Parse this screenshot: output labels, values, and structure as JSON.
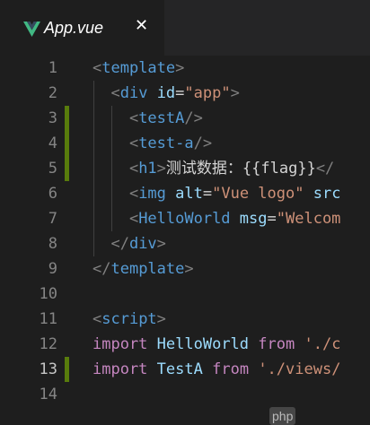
{
  "tab": {
    "title": "App.vue",
    "icon": "vue-logo-icon",
    "close": "✕"
  },
  "editor": {
    "lines": [
      {
        "n": "1",
        "segs": [
          [
            "p",
            "<"
          ],
          [
            "tg",
            "template"
          ],
          [
            "p",
            ">"
          ]
        ]
      },
      {
        "n": "2",
        "segs": [
          [
            "p",
            "  <"
          ],
          [
            "tg",
            "div"
          ],
          [
            "tx",
            " "
          ],
          [
            "at",
            "id"
          ],
          [
            "tx",
            "="
          ],
          [
            "st",
            "\"app\""
          ],
          [
            "p",
            ">"
          ]
        ]
      },
      {
        "n": "3",
        "mark": true,
        "segs": [
          [
            "p",
            "    <"
          ],
          [
            "tg",
            "testA"
          ],
          [
            "p",
            "/>"
          ]
        ]
      },
      {
        "n": "4",
        "mark": true,
        "segs": [
          [
            "p",
            "    <"
          ],
          [
            "tg",
            "test-a"
          ],
          [
            "p",
            "/>"
          ]
        ]
      },
      {
        "n": "5",
        "mark": true,
        "segs": [
          [
            "p",
            "    <"
          ],
          [
            "tg",
            "h1"
          ],
          [
            "p",
            ">"
          ],
          [
            "tx",
            "测试数据：{{flag}}"
          ],
          [
            "p",
            "</"
          ]
        ]
      },
      {
        "n": "6",
        "segs": [
          [
            "p",
            "    <"
          ],
          [
            "tg",
            "img"
          ],
          [
            "tx",
            " "
          ],
          [
            "at",
            "alt"
          ],
          [
            "tx",
            "="
          ],
          [
            "st",
            "\"Vue logo\""
          ],
          [
            "tx",
            " "
          ],
          [
            "at",
            "src"
          ]
        ]
      },
      {
        "n": "7",
        "segs": [
          [
            "p",
            "    <"
          ],
          [
            "tg",
            "HelloWorld"
          ],
          [
            "tx",
            " "
          ],
          [
            "at",
            "msg"
          ],
          [
            "tx",
            "="
          ],
          [
            "st",
            "\"Welcom"
          ]
        ]
      },
      {
        "n": "8",
        "segs": [
          [
            "p",
            "  </"
          ],
          [
            "tg",
            "div"
          ],
          [
            "p",
            ">"
          ]
        ]
      },
      {
        "n": "9",
        "segs": [
          [
            "p",
            "</"
          ],
          [
            "tg",
            "template"
          ],
          [
            "p",
            ">"
          ]
        ]
      },
      {
        "n": "10",
        "segs": []
      },
      {
        "n": "11",
        "segs": [
          [
            "p",
            "<"
          ],
          [
            "tg",
            "script"
          ],
          [
            "p",
            ">"
          ]
        ]
      },
      {
        "n": "12",
        "segs": [
          [
            "kw",
            "import"
          ],
          [
            "tx",
            " "
          ],
          [
            "id",
            "HelloWorld"
          ],
          [
            "tx",
            " "
          ],
          [
            "kw",
            "from"
          ],
          [
            "tx",
            " "
          ],
          [
            "st",
            "'./c"
          ]
        ]
      },
      {
        "n": "13",
        "mark": true,
        "active": true,
        "segs": [
          [
            "kw",
            "import"
          ],
          [
            "tx",
            " "
          ],
          [
            "id",
            "TestA"
          ],
          [
            "tx",
            " "
          ],
          [
            "kw",
            "from"
          ],
          [
            "tx",
            " "
          ],
          [
            "st",
            "'./views/"
          ]
        ]
      },
      {
        "n": "14",
        "segs": []
      }
    ]
  },
  "watermark": {
    "text": "php"
  },
  "colors": {
    "gutter_modified": "#587c0c",
    "tag": "#569cd6",
    "attr": "#9cdcfe",
    "string": "#ce9178",
    "keyword": "#c586c0"
  }
}
